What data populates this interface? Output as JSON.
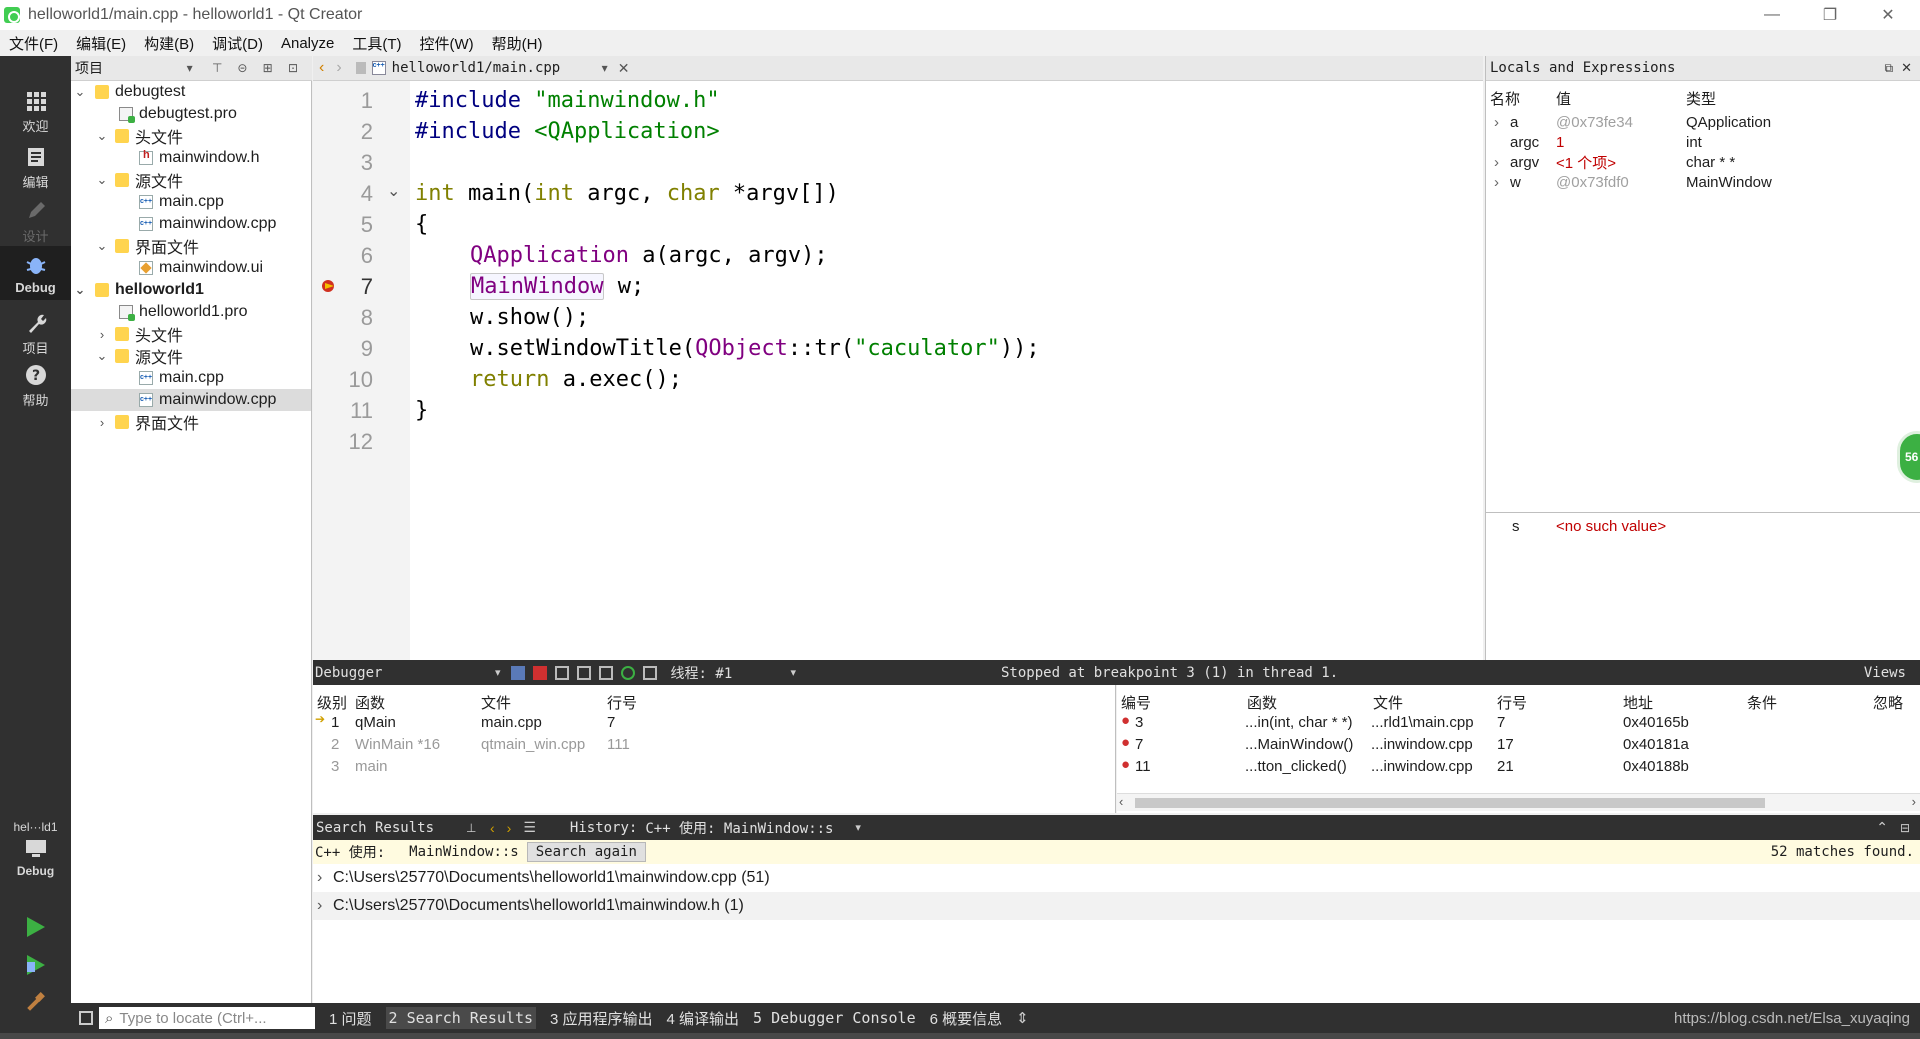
{
  "window": {
    "title": "helloworld1/main.cpp - helloworld1 - Qt Creator",
    "minimize": "—",
    "restore": "❐",
    "close": "✕"
  },
  "menus": [
    "文件(F)",
    "编辑(E)",
    "构建(B)",
    "调试(D)",
    "Analyze",
    "工具(T)",
    "控件(W)",
    "帮助(H)"
  ],
  "modes": {
    "welcome": "欢迎",
    "edit": "编辑",
    "design": "设计",
    "debug": "Debug",
    "projects": "项目",
    "help": "帮助",
    "kit": "hel···ld1",
    "kit_mode": "Debug"
  },
  "project_panel": {
    "title": "项目",
    "tree": [
      {
        "label": "debugtest",
        "type": "project"
      },
      {
        "label": "debugtest.pro",
        "type": "pro"
      },
      {
        "label": "头文件",
        "type": "folder"
      },
      {
        "label": "mainwindow.h",
        "type": "header"
      },
      {
        "label": "源文件",
        "type": "folder"
      },
      {
        "label": "main.cpp",
        "type": "cpp"
      },
      {
        "label": "mainwindow.cpp",
        "type": "cpp"
      },
      {
        "label": "界面文件",
        "type": "folder"
      },
      {
        "label": "mainwindow.ui",
        "type": "ui"
      },
      {
        "label": "helloworld1",
        "type": "project"
      },
      {
        "label": "helloworld1.pro",
        "type": "pro"
      },
      {
        "label": "头文件",
        "type": "folder"
      },
      {
        "label": "源文件",
        "type": "folder"
      },
      {
        "label": "main.cpp",
        "type": "cpp"
      },
      {
        "label": "mainwindow.cpp",
        "type": "cpp",
        "selected": true
      },
      {
        "label": "界面文件",
        "type": "folder"
      }
    ]
  },
  "editor": {
    "file_tab": "helloworld1/main.cpp",
    "line_numbers": [
      "1",
      "2",
      "3",
      "4",
      "5",
      "6",
      "7",
      "8",
      "9",
      "10",
      "11",
      "12"
    ],
    "current_line": "7",
    "code": {
      "l1_pp": "#include",
      "l1_str": "\"mainwindow.h\"",
      "l2_pp": "#include",
      "l2_str": "<QApplication>",
      "l4_kw1": "int",
      "l4_fn": "main",
      "l4_p1": "(",
      "l4_kw2": "int",
      "l4_p2": " argc, ",
      "l4_kw3": "char",
      "l4_p3": " *argv[])",
      "l5": "{",
      "l6_typ": "QApplication",
      "l6_rest": " a(argc, argv);",
      "l7_typ": "MainWindow",
      "l7_rest": " w;",
      "l8": "w.show();",
      "l9_a": "w.setWindowTitle(",
      "l9_typ": "QObject",
      "l9_b": "::tr(",
      "l9_str": "\"caculator\"",
      "l9_c": "));",
      "l10_kw": "return",
      "l10_rest": " a.exec();",
      "l11": "}"
    }
  },
  "locals": {
    "title": "Locals and Expressions",
    "headers": {
      "name": "名称",
      "value": "值",
      "type": "类型"
    },
    "rows": [
      {
        "name": "a",
        "value": "@0x73fe34",
        "type": "QApplication"
      },
      {
        "name": "argc",
        "value": "1",
        "type": "int"
      },
      {
        "name": "argv",
        "value": "<1 个项>",
        "type": "char * *"
      },
      {
        "name": "w",
        "value": "@0x73fdf0",
        "type": "MainWindow"
      }
    ],
    "expression": {
      "name": "s",
      "value": "<no such value>"
    },
    "badge": "56"
  },
  "debugger_bar": {
    "label": "Debugger",
    "thread": "线程: #1",
    "status": "Stopped at breakpoint 3 (1) in thread 1.",
    "views": "Views"
  },
  "stack": {
    "headers": {
      "level": "级别",
      "function": "函数",
      "file": "文件",
      "line": "行号"
    },
    "rows": [
      {
        "level": "1",
        "function": "qMain",
        "file": "main.cpp",
        "line": "7"
      },
      {
        "level": "2",
        "function": "WinMain *16",
        "file": "qtmain_win.cpp",
        "line": "111"
      },
      {
        "level": "3",
        "function": "main",
        "file": "",
        "line": ""
      }
    ]
  },
  "breakpoints": {
    "headers": {
      "number": "编号",
      "function": "函数",
      "file": "文件",
      "line": "行号",
      "address": "地址",
      "condition": "条件",
      "ignore": "忽略"
    },
    "rows": [
      {
        "number": "3",
        "function": "...in(int, char * *)",
        "file": "...rld1\\main.cpp",
        "line": "7",
        "address": "0x40165b"
      },
      {
        "number": "7",
        "function": "...MainWindow()",
        "file": "...inwindow.cpp",
        "line": "17",
        "address": "0x40181a"
      },
      {
        "number": "11",
        "function": "...tton_clicked()",
        "file": "...inwindow.cpp",
        "line": "21",
        "address": "0x40188b"
      }
    ]
  },
  "search": {
    "title": "Search Results",
    "history_label": "History:",
    "history_value": "C++ 使用: MainWindow::s",
    "info_label": "C++ 使用:",
    "info_term": "MainWindow::s",
    "again": "Search again",
    "matches": "52 matches found.",
    "results": [
      "C:\\Users\\25770\\Documents\\helloworld1\\mainwindow.cpp (51)",
      "C:\\Users\\25770\\Documents\\helloworld1\\mainwindow.h (1)"
    ]
  },
  "statusbar": {
    "locator_placeholder": "Type to locate (Ctrl+...",
    "panes": [
      "1 问题",
      "2 Search Results",
      "3 应用程序输出",
      "4 编译输出",
      "5 Debugger Console",
      "6 概要信息"
    ],
    "watermark": "https://blog.csdn.net/Elsa_xuyaqing"
  }
}
